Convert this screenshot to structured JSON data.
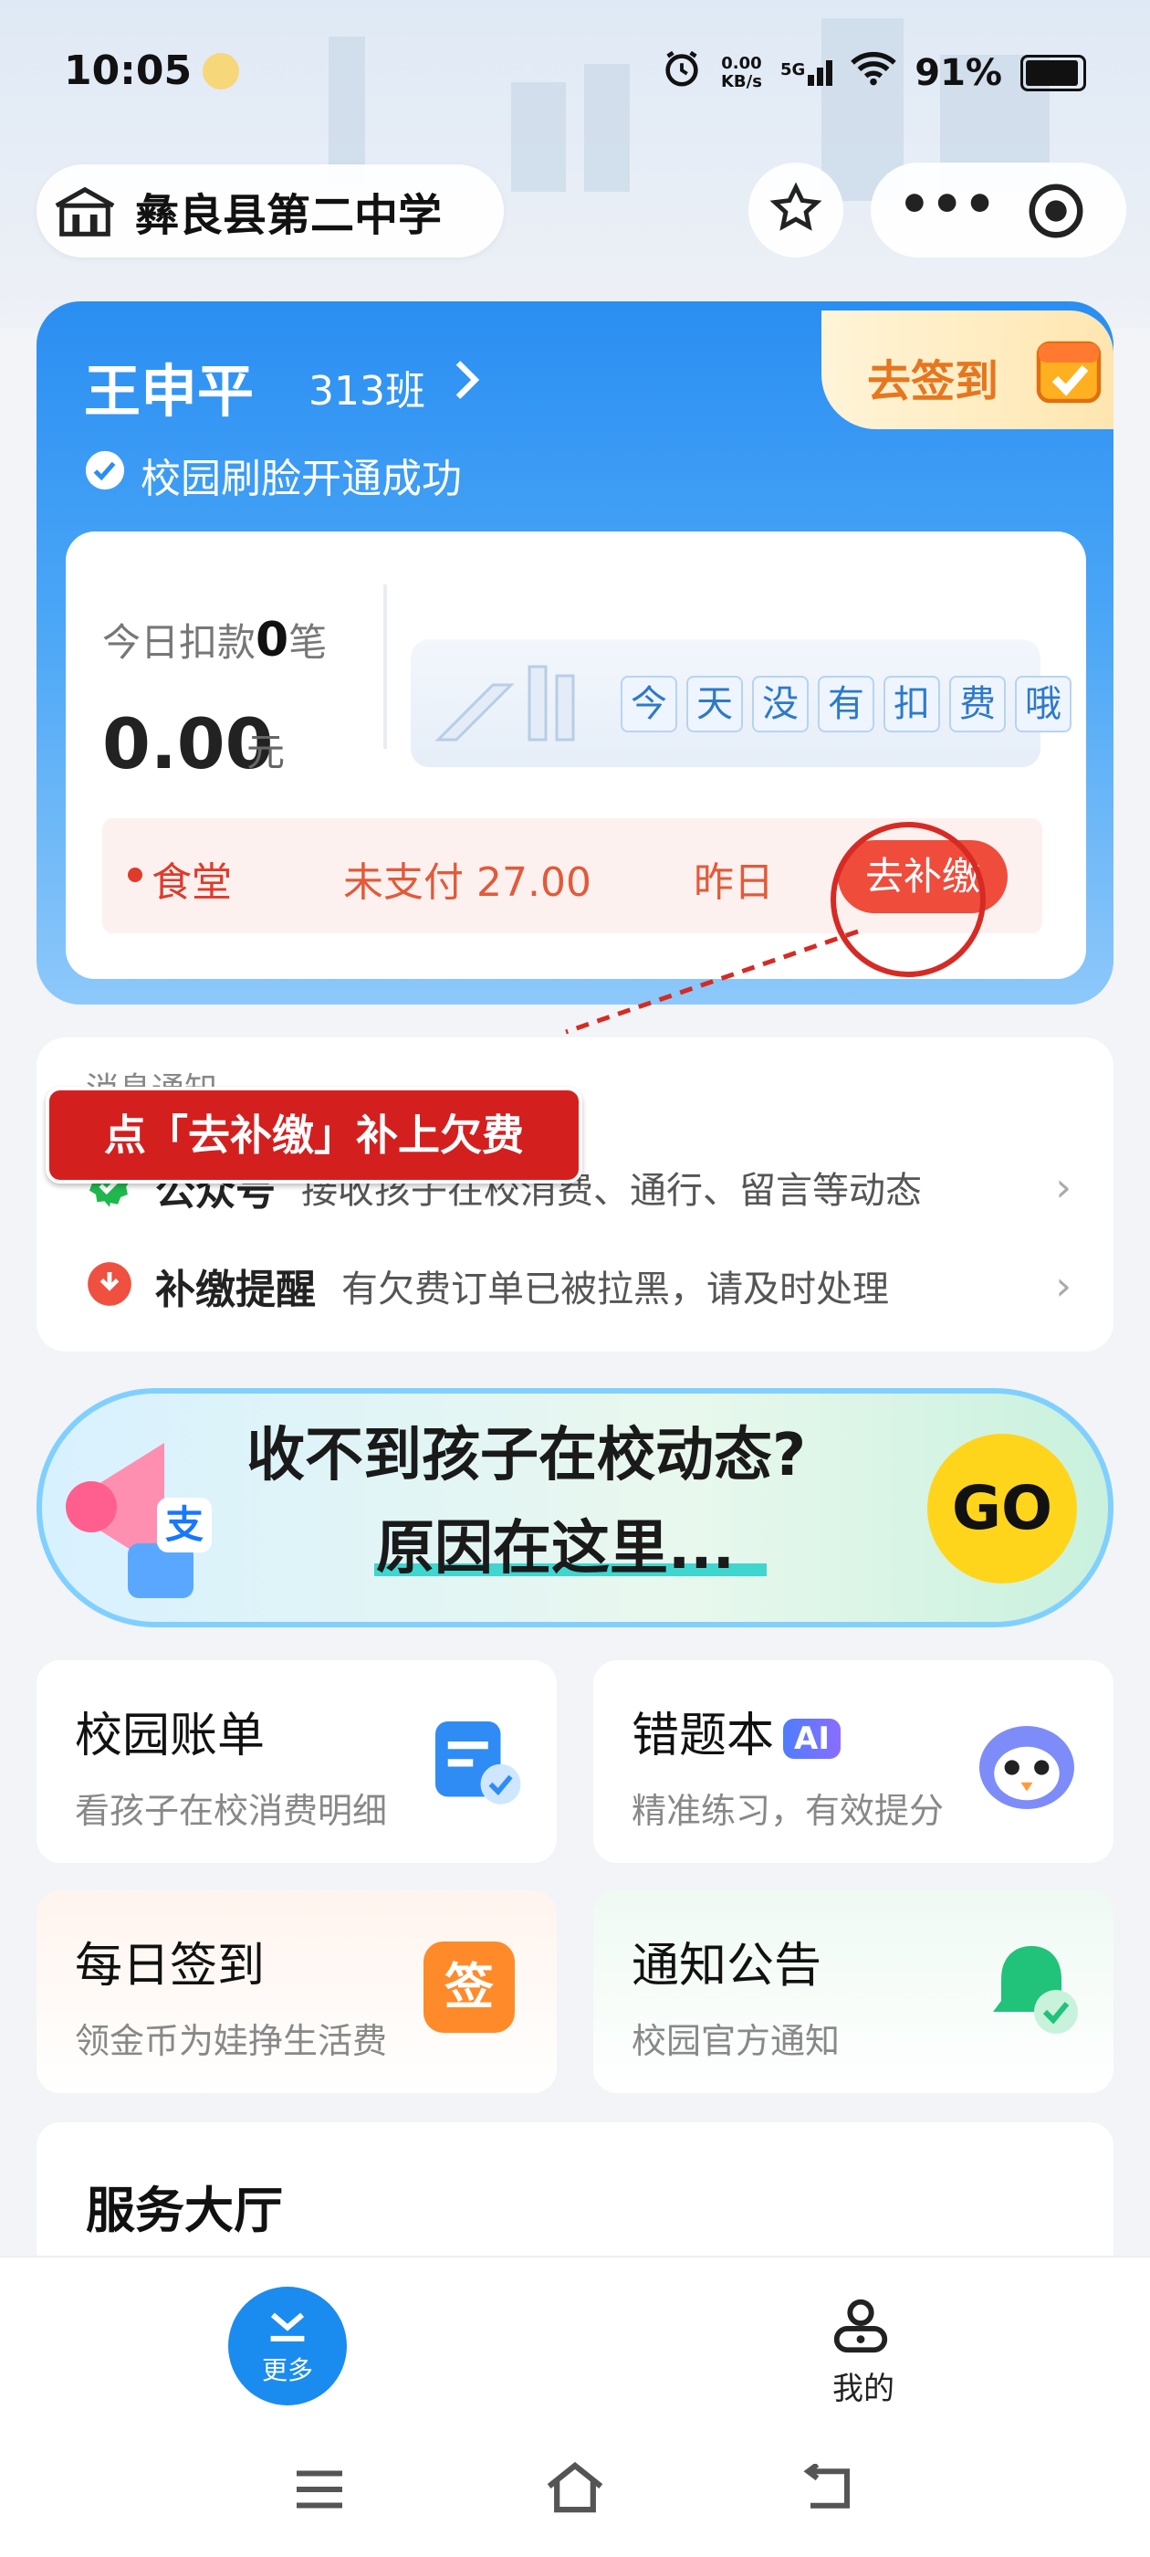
{
  "status_bar": {
    "time": "10:05",
    "net_speed_top": "0.00",
    "net_speed_bottom": "KB/s",
    "signal": "5G",
    "battery": "91%"
  },
  "header": {
    "school_name": "彝良县第二中学"
  },
  "profile": {
    "name": "王申平",
    "class": "313班",
    "face_status": "校园刷脸开通成功",
    "checkin_label": "去签到",
    "today_prefix": "今日扣款",
    "today_count": "0",
    "today_suffix": "笔",
    "amount": "0.00",
    "amount_unit": "元",
    "no_fee_chars": [
      "今",
      "天",
      "没",
      "有",
      "扣",
      "费",
      "哦"
    ]
  },
  "owed": {
    "category": "食堂",
    "status": "未支付 27.00",
    "date": "昨日",
    "button": "去补缴"
  },
  "annotation": {
    "callout": "点「去补缴」补上欠费"
  },
  "messages": {
    "title": "消息通知",
    "rows": [
      {
        "label": "公众号",
        "desc": "接收孩子在校消费、通行、留言等动态"
      },
      {
        "label": "补缴提醒",
        "desc": "有欠费订单已被拉黑，请及时处理"
      }
    ]
  },
  "banner": {
    "line1": "收不到孩子在校动态?",
    "line2": "原因在这里...",
    "go": "GO",
    "alipay_char": "支"
  },
  "tiles": [
    {
      "title": "校园账单",
      "sub": "看孩子在校消费明细"
    },
    {
      "title": "错题本",
      "badge": "AI",
      "sub": "精准练习，有效提分"
    },
    {
      "title": "每日签到",
      "sub": "领金币为娃挣生活费",
      "icon_char": "签"
    },
    {
      "title": "通知公告",
      "sub": "校园官方通知"
    }
  ],
  "service": {
    "title": "服务大厅"
  },
  "tabbar": {
    "more": "更多",
    "mine": "我的"
  },
  "colors": {
    "card_blue": "#2a8ef2",
    "pay_red": "#ef4c3c",
    "callout_red": "#d41f1f",
    "go_yellow": "#ffd51c"
  }
}
